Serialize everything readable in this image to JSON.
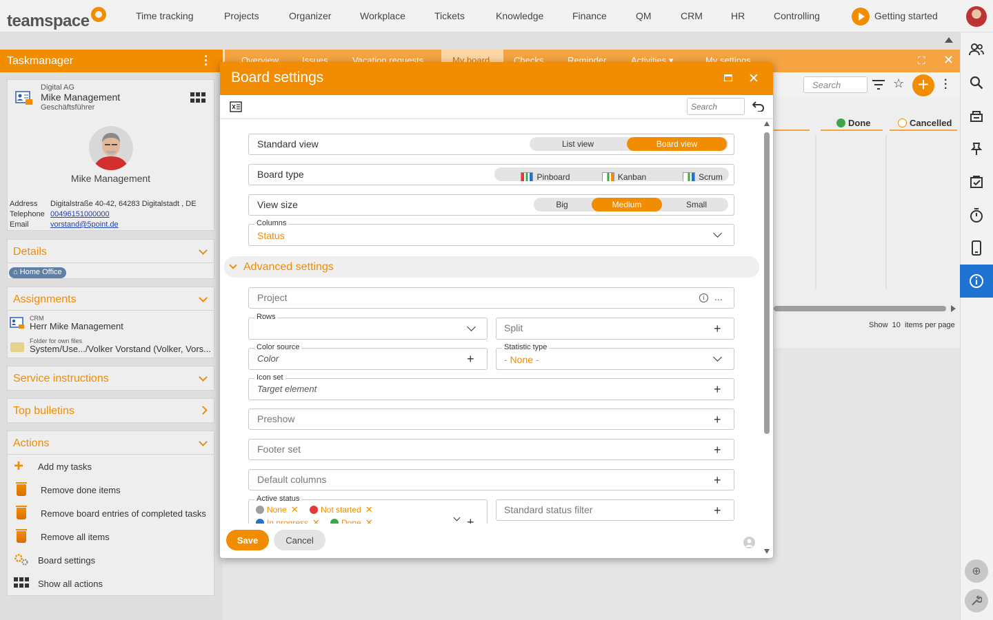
{
  "topnav": {
    "logo": "teamspace",
    "items": [
      "Time tracking",
      "Projects",
      "Organizer",
      "Workplace",
      "Tickets",
      "Knowledge",
      "Finance",
      "QM",
      "CRM",
      "HR",
      "Controlling"
    ],
    "getting_started": "Getting started"
  },
  "left": {
    "title": "Taskmanager",
    "contact": {
      "company": "Digital AG",
      "name": "Mike Management",
      "role": "Geschäftsführer",
      "display_name": "Mike Management",
      "address_label": "Address",
      "address": "Digitalstraße 40-42, 64283 Digitalstadt , DE",
      "telephone_label": "Telephone",
      "telephone": "00496151000000",
      "email_label": "Email",
      "email": "vorstand@5point.de"
    },
    "details": {
      "title": "Details",
      "badge": "Home Office"
    },
    "assignments": {
      "title": "Assignments",
      "items": [
        {
          "small": "CRM",
          "text": "Herr Mike Management"
        },
        {
          "small": "Folder for own files",
          "text": "System/Use.../Volker Vorstand (Volker, Vors..."
        }
      ]
    },
    "service_instructions": "Service instructions",
    "top_bulletins": "Top bulletins",
    "actions": {
      "title": "Actions",
      "items": [
        "Add my tasks",
        "Remove done items",
        "Remove board entries of completed tasks",
        "Remove all items",
        "Board settings",
        "Show all actions"
      ]
    }
  },
  "background": {
    "tabs": [
      "Overview",
      "Issues",
      "Vacation requests",
      "My board",
      "Checks",
      "Reminder",
      "Activities ▾",
      "My settings"
    ],
    "search_placeholder": "Search",
    "columns": [
      {
        "label": "Done",
        "color": "#3aa847"
      },
      {
        "label": "Cancelled",
        "color": "#f28c00"
      }
    ],
    "pager": {
      "show": "Show",
      "count": "10",
      "suffix": "items per page"
    }
  },
  "modal": {
    "title": "Board settings",
    "search_placeholder": "Search",
    "standard_view": {
      "label": "Standard view",
      "options": [
        "List view",
        "Board view"
      ],
      "selected": "Board view"
    },
    "board_type": {
      "label": "Board type",
      "options": [
        "Pinboard",
        "Kanban",
        "Scrum"
      ]
    },
    "view_size": {
      "label": "View size",
      "options": [
        "Big",
        "Medium",
        "Small"
      ],
      "selected": "Medium"
    },
    "columns": {
      "label": "Columns",
      "value": "Status"
    },
    "advanced": "Advanced settings",
    "project": {
      "placeholder": "Project"
    },
    "rows": {
      "label": "Rows",
      "value": ""
    },
    "split": {
      "placeholder": "Split"
    },
    "color_source": {
      "label": "Color source",
      "placeholder": "Color"
    },
    "statistic_type": {
      "label": "Statistic type",
      "value": "- None -"
    },
    "icon_set": {
      "label": "Icon set",
      "placeholder": "Target element"
    },
    "preshow": {
      "placeholder": "Preshow"
    },
    "footer_set": {
      "placeholder": "Footer set"
    },
    "default_columns": {
      "placeholder": "Default columns"
    },
    "active_status": {
      "label": "Active status",
      "chips": [
        {
          "label": "None",
          "color": "#9e9e9e"
        },
        {
          "label": "Not started",
          "color": "#e53935"
        },
        {
          "label": "In progress",
          "color": "#1e73d2"
        },
        {
          "label": "Done",
          "color": "#3aa847"
        }
      ]
    },
    "standard_status_filter": {
      "placeholder": "Standard status filter"
    },
    "save": "Save",
    "cancel": "Cancel"
  },
  "colors": {
    "accent": "#f28c00",
    "rail_active": "#1e73d2"
  }
}
